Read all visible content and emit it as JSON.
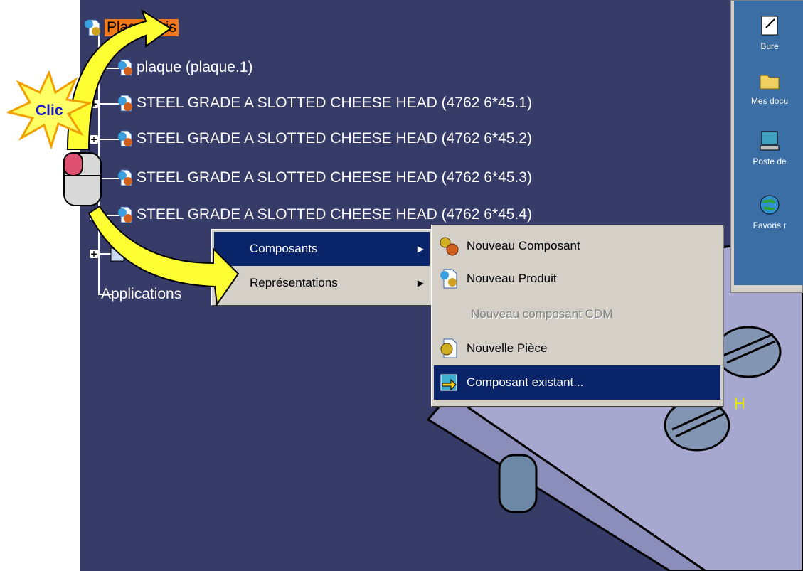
{
  "tree": {
    "root_label": "Plaque-vis",
    "child_label": "plaque (plaque.1)",
    "screws": [
      "STEEL GRADE A SLOTTED CHEESE HEAD (4762 6*45.1)",
      "STEEL GRADE A SLOTTED CHEESE HEAD (4762 6*45.2)",
      "STEEL GRADE A SLOTTED CHEESE HEAD (4762 6*45.3)",
      "STEEL GRADE A SLOTTED CHEESE HEAD (4762 6*45.4)"
    ],
    "applications_label": "Applications"
  },
  "annotation": {
    "clic_label": "Clic"
  },
  "desktop": {
    "icons": [
      {
        "label": "Bure",
        "icon": "notepad-icon"
      },
      {
        "label": "Mes docu",
        "icon": "folder-icon"
      },
      {
        "label": "Poste de",
        "icon": "computer-icon"
      },
      {
        "label": "Favoris r",
        "icon": "globe-icon"
      }
    ]
  },
  "context_menu": {
    "items": [
      {
        "label": "Composants",
        "mnemonic": "m",
        "has_submenu": true,
        "selected": true
      },
      {
        "label": "Représentations",
        "mnemonic": "é",
        "has_submenu": true,
        "selected": false
      }
    ]
  },
  "submenu": {
    "items": [
      {
        "label": "Nouveau Composant",
        "mnemonic": "N",
        "icon": "gear-component-icon",
        "enabled": true,
        "selected": false
      },
      {
        "label": "Nouveau Produit",
        "mnemonic": "o",
        "icon": "product-icon",
        "enabled": true,
        "selected": false
      },
      {
        "label": "Nouveau composant CDM",
        "mnemonic": "u",
        "icon": "",
        "enabled": false,
        "selected": false
      },
      {
        "label": "Nouvelle Pièce",
        "mnemonic": "v",
        "icon": "part-icon",
        "enabled": true,
        "selected": false
      },
      {
        "label": "Composant existant...",
        "mnemonic": "C",
        "icon": "insert-arrow-icon",
        "enabled": true,
        "selected": true
      }
    ]
  },
  "colors": {
    "viewport_bg": "#373b68",
    "menu_bg": "#d4d0c8",
    "selection": "#0a246a",
    "root_highlight": "#f07a1a",
    "arrow_fill": "#ffff33"
  }
}
